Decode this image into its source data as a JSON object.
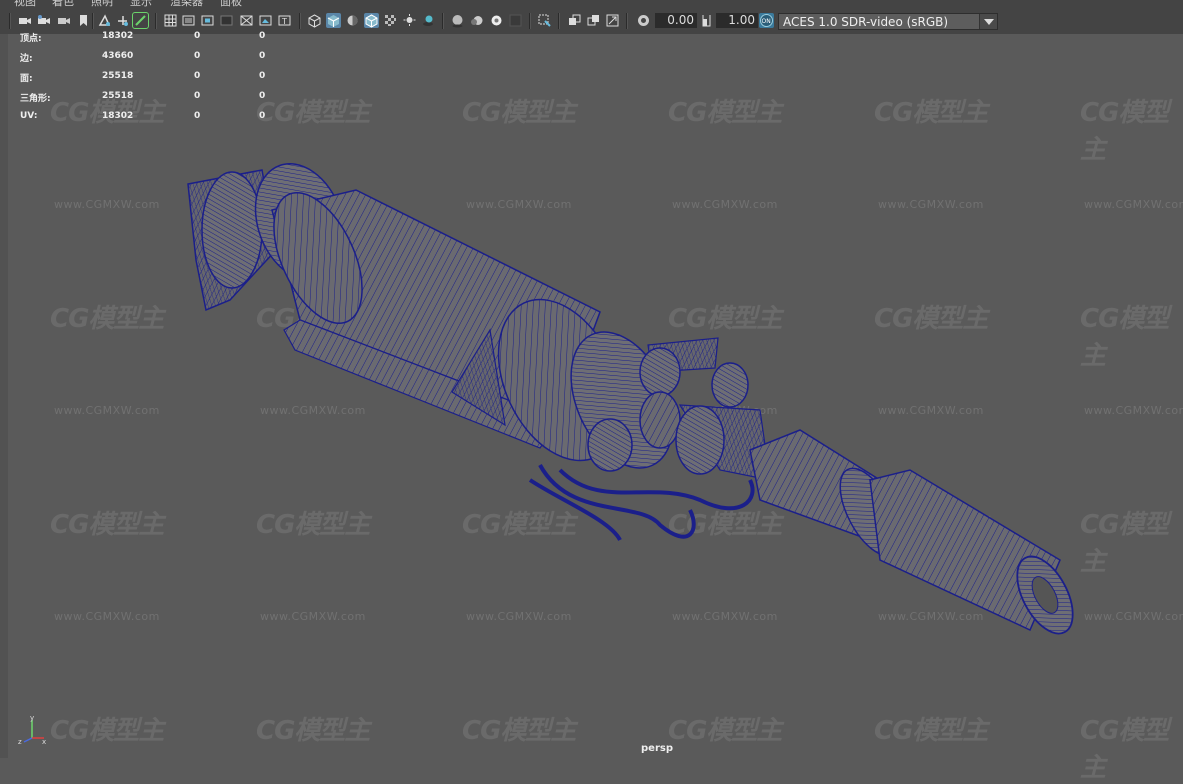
{
  "menu": {
    "items": [
      "视图",
      "着色",
      "照明",
      "显示",
      "渲染器",
      "面板"
    ]
  },
  "toolbar": {
    "exposure_value": "0.00",
    "gamma_value": "1.00",
    "color_space": "ACES 1.0 SDR-video (sRGB)",
    "icons": [
      "camera-select-icon",
      "camera-attr-icon",
      "bookmark-icon",
      "image-plane-icon",
      "grid-icon",
      "film-gate-icon",
      "resolution-gate-icon",
      "gate-mask-icon",
      "field-chart-icon",
      "safe-action-icon",
      "safe-title-icon",
      "wireframe-icon",
      "smooth-shade-icon",
      "default-material-icon",
      "wireframe-on-shaded-icon",
      "xray-icon",
      "use-default-lights-icon",
      "shadows-icon",
      "screen-space-ao-icon",
      "motion-blur-icon",
      "multisample-aa-icon",
      "depth-of-field-icon",
      "isolate-select-icon",
      "xray-joints-icon",
      "xray-active-icon",
      "backface-icon",
      "exposure-icon",
      "gamma-icon",
      "color-management-icon"
    ]
  },
  "hud": {
    "rows": [
      {
        "label": "顶点:",
        "v1": "18302",
        "v2": "0",
        "v3": "0"
      },
      {
        "label": "边:",
        "v1": "43660",
        "v2": "0",
        "v3": "0"
      },
      {
        "label": "面:",
        "v1": "25518",
        "v2": "0",
        "v3": "0"
      },
      {
        "label": "三角形:",
        "v1": "25518",
        "v2": "0",
        "v3": "0"
      },
      {
        "label": "UV:",
        "v1": "18302",
        "v2": "0",
        "v3": "0"
      }
    ]
  },
  "viewport": {
    "camera_label": "persp",
    "background": "#5a5a5a",
    "wire_color": "#1b1f8a"
  },
  "axis": {
    "x": "x",
    "y": "y",
    "z": "z"
  },
  "watermark": {
    "logo": "CG模型主",
    "url": "www.CGMXW.com"
  }
}
